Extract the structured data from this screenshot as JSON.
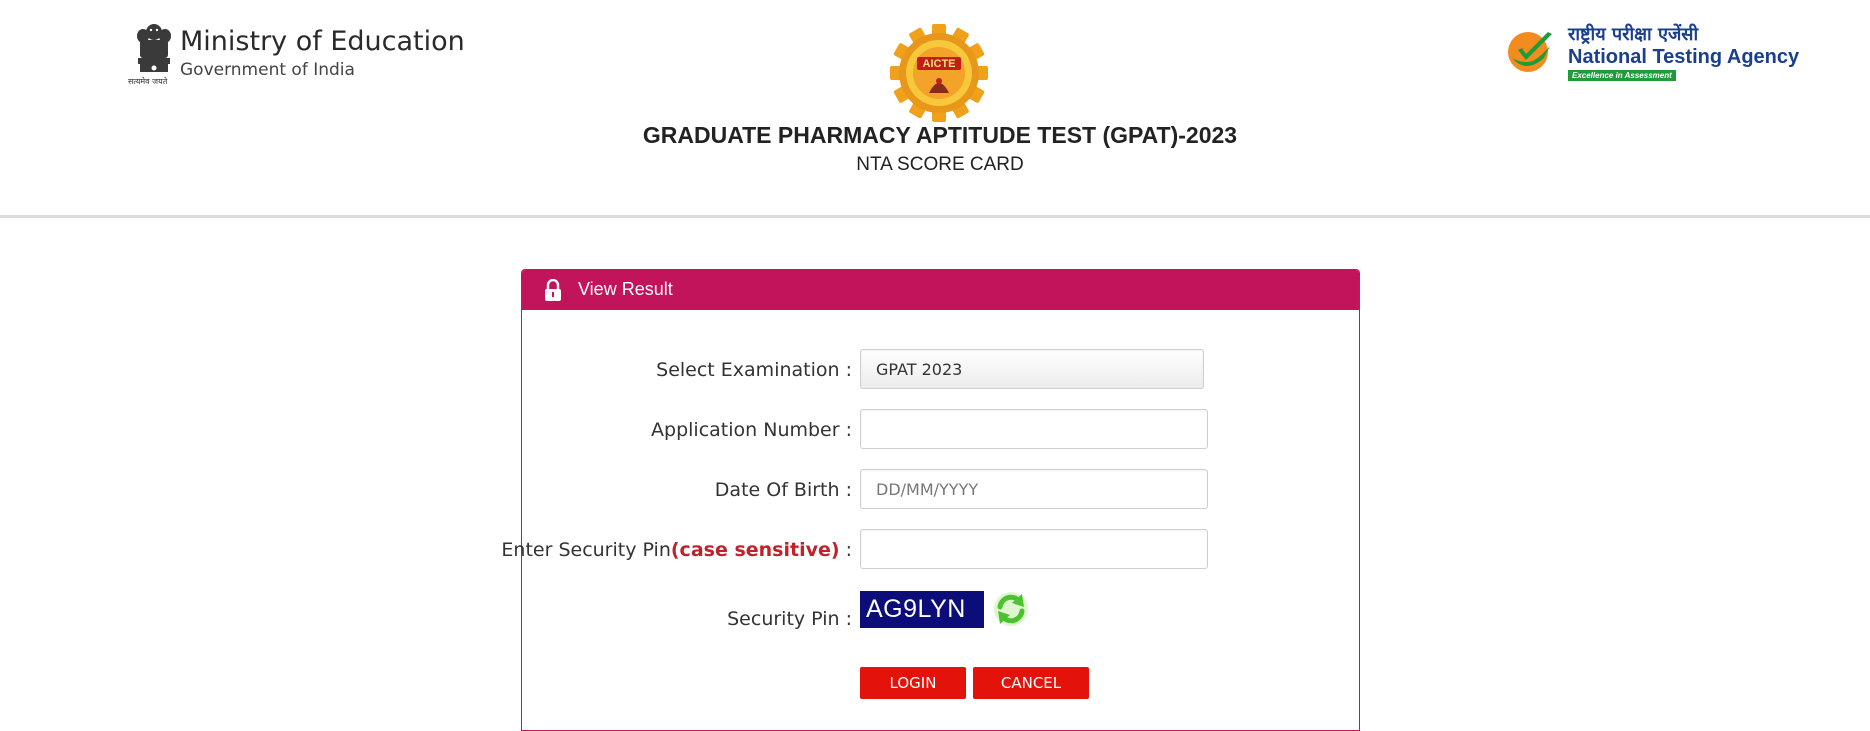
{
  "header": {
    "ministry": {
      "title": "Ministry of Education",
      "subtitle": "Government of India",
      "emblem_motto": "सत्यमेव जयते",
      "emblem_icon": "state-emblem-icon"
    },
    "aicte": {
      "label": "AICTE",
      "icon": "aicte-gear-logo"
    },
    "nta": {
      "hindi": "राष्ट्रीय परीक्षा एजेंसी",
      "name": "National Testing Agency",
      "tagline": "Excellence in Assessment",
      "icon": "nta-check-logo"
    },
    "exam_title": "GRADUATE PHARMACY APTITUDE TEST (GPAT)-2023",
    "exam_subtitle": "NTA SCORE CARD"
  },
  "panel": {
    "title": "View Result",
    "icon": "lock-icon",
    "header_color": "#c2145a"
  },
  "form": {
    "examination": {
      "label": "Select Examination :",
      "value": "GPAT 2023"
    },
    "application_number": {
      "label": "Application Number :",
      "value": "",
      "placeholder": ""
    },
    "dob": {
      "label": "Date Of Birth :",
      "value": "",
      "placeholder": "DD/MM/YYYY"
    },
    "security_pin_input": {
      "label_main": "Enter Security Pin",
      "label_note": "(case sensitive)",
      "label_suffix": " :",
      "value": ""
    },
    "security_pin": {
      "label": "Security Pin :",
      "captcha_text": "AG9LYN",
      "refresh_icon": "refresh-icon"
    },
    "buttons": {
      "login": "LOGIN",
      "cancel": "CANCEL",
      "color": "#e3120b"
    }
  }
}
